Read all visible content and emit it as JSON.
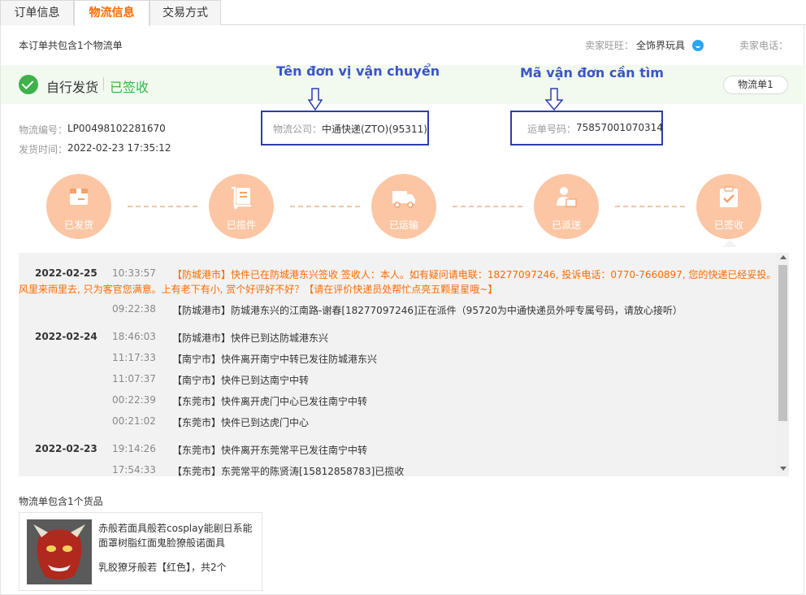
{
  "tabs": [
    {
      "label": "订单信息"
    },
    {
      "label": "物流信息"
    },
    {
      "label": "交易方式"
    }
  ],
  "summary": "本订单共包含1个物流单",
  "seller": {
    "wangwang_label": "卖家旺旺：",
    "wangwang_name": "全饰界玩具",
    "phone_label": "卖家电话："
  },
  "status": {
    "ship_mode": "自行发货",
    "state": "已签收",
    "logistics_button": "物流单1"
  },
  "annotations": {
    "carrier_note": "Tên đơn vị vận chuyển",
    "tracking_note": "Mã vận đơn cần tìm"
  },
  "shipment": {
    "id_label": "物流编号：",
    "id_value": "LP00498102281670",
    "time_label": "发货时间：",
    "time_value": "2022-02-23 17:35:12",
    "carrier_label": "物流公司：",
    "carrier_value": "中通快递(ZTO)(95311)",
    "tracking_label": "运单号码：",
    "tracking_value": "75857001070314"
  },
  "steps": [
    {
      "label": "已发货",
      "icon": "box-icon"
    },
    {
      "label": "已揽件",
      "icon": "cart-icon"
    },
    {
      "label": "已运输",
      "icon": "truck-icon"
    },
    {
      "label": "已派送",
      "icon": "courier-icon"
    },
    {
      "label": "已签收",
      "icon": "clipboard-check-icon"
    }
  ],
  "tracking": [
    {
      "date": "2022-02-25",
      "time": "10:33:57",
      "text": "【防城港市】快件已在防城港东兴签收 签收人：本人。如有疑问请电联：18277097246, 投诉电话：0770-7660897, 您的快递已经妥投。",
      "text2": "风里来雨里去, 只为客官您满意。上有老下有小, 赏个好评好不好？【请在评价快递员处帮忙点亮五颗星星哦~】"
    },
    {
      "date": "",
      "time": "09:22:38",
      "text": "【防城港市】防城港东兴的江南路-谢春[18277097246]正在派件（95720为中通快递员外呼专属号码，请放心接听）"
    },
    {
      "date": "2022-02-24",
      "time": "18:46:03",
      "text": "【防城港市】快件已到达防城港东兴"
    },
    {
      "date": "",
      "time": "11:17:33",
      "text": "【南宁市】快件离开南宁中转已发往防城港东兴"
    },
    {
      "date": "",
      "time": "11:07:37",
      "text": "【南宁市】快件已到达南宁中转"
    },
    {
      "date": "",
      "time": "00:22:39",
      "text": "【东莞市】快件离开虎门中心已发往南宁中转"
    },
    {
      "date": "",
      "time": "00:21:02",
      "text": "【东莞市】快件已到达虎门中心"
    },
    {
      "date": "2022-02-23",
      "time": "19:14:26",
      "text": "【东莞市】快件离开东莞常平已发往南宁中转"
    },
    {
      "date": "",
      "time": "17:54:33",
      "text": "【东莞市】东莞常平的陈贤涛[15812858783]已揽收"
    }
  ],
  "goods": {
    "title": "物流单包含1个货品",
    "name": "赤般若面具般若cosplay能剧日系能面罩树脂红面鬼脸獠般诺面具",
    "sku": "乳胶獠牙般若【红色】，共2个"
  },
  "colors": {
    "accent": "#ff6a00",
    "success": "#3db24a",
    "step_fill": "#fcc6a4",
    "annotation": "#3a55c9",
    "box_border": "#2c3ea8"
  }
}
